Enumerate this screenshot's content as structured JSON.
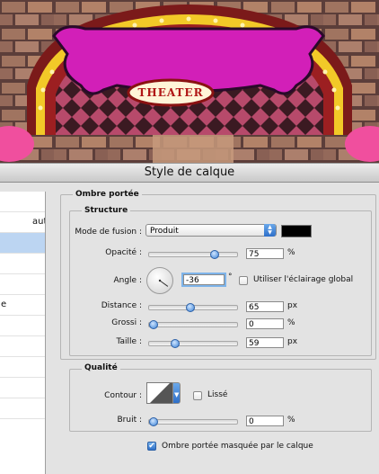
{
  "theater_sign": "THEATER",
  "window_title": "Style de calque",
  "left_list": {
    "items": [
      "",
      "aut",
      "",
      "",
      "",
      "e",
      "",
      "",
      "",
      "",
      ""
    ],
    "selected_index": 2
  },
  "ombre": {
    "title": "Ombre portée",
    "structure_title": "Structure",
    "blend_label": "Mode de fusion :",
    "blend_value": "Produit",
    "shadow_color": "#000000",
    "opacity_label": "Opacité :",
    "opacity_value": "75",
    "opacity_unit": "%",
    "opacity_level": 0.75,
    "angle_label": "Angle :",
    "angle_value": "-36",
    "angle_unit": "°",
    "global_light_label": "Utiliser l'éclairage global",
    "global_light_checked": false,
    "distance_label": "Distance :",
    "distance_value": "65",
    "distance_unit": "px",
    "distance_level": 0.45,
    "spread_label": "Grossi :",
    "spread_value": "0",
    "spread_unit": "%",
    "spread_level": 0.0,
    "size_label": "Taille :",
    "size_value": "59",
    "size_unit": "px",
    "size_level": 0.27
  },
  "quality": {
    "title": "Qualité",
    "contour_label": "Contour :",
    "smooth_label": "Lissé",
    "smooth_checked": false,
    "noise_label": "Bruit :",
    "noise_value": "0",
    "noise_unit": "%",
    "noise_level": 0.0,
    "knockout_label": "Ombre portée masquée par le calque",
    "knockout_checked": true
  }
}
